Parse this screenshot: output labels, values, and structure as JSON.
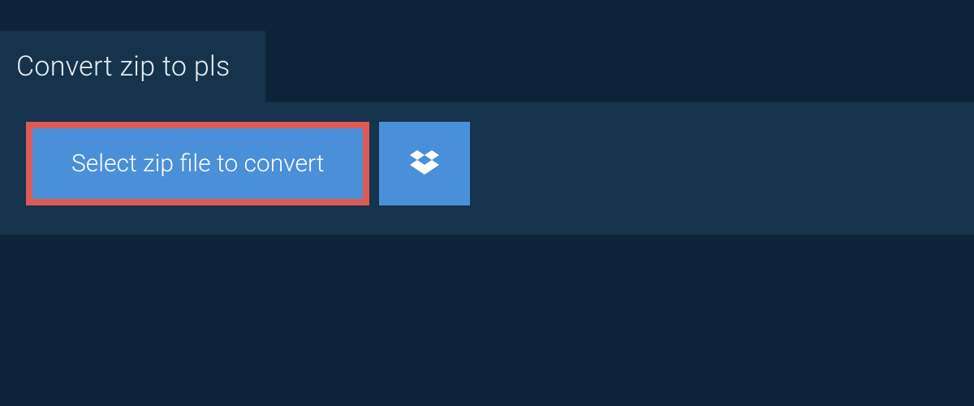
{
  "header": {
    "title": "Convert zip to pls"
  },
  "actions": {
    "select_file_label": "Select zip file to convert",
    "dropbox_icon": "dropbox-icon"
  },
  "colors": {
    "background_dark": "#0d2438",
    "panel": "#15334d",
    "button_primary": "#4a90d9",
    "highlight_border": "#de5a54",
    "text_light": "#ffffff"
  }
}
